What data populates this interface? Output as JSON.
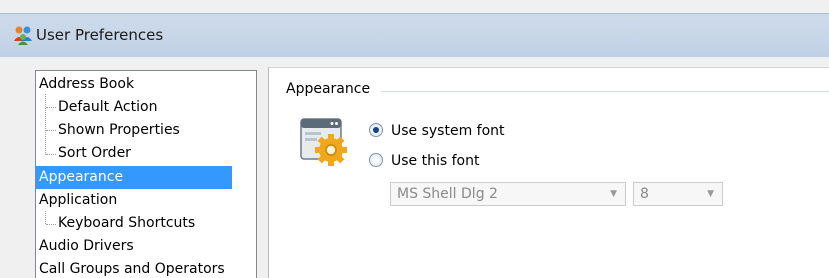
{
  "window": {
    "title": "User Preferences",
    "icon": "user-preferences-app-icon"
  },
  "tree": {
    "items": [
      {
        "label": "Address Book",
        "level": 0,
        "selected": false
      },
      {
        "label": "Default Action",
        "level": 1,
        "selected": false
      },
      {
        "label": "Shown Properties",
        "level": 1,
        "selected": false
      },
      {
        "label": "Sort Order",
        "level": 1,
        "selected": false
      },
      {
        "label": "Appearance",
        "level": 0,
        "selected": true
      },
      {
        "label": "Application",
        "level": 0,
        "selected": false
      },
      {
        "label": "Keyboard Shortcuts",
        "level": 1,
        "selected": false
      },
      {
        "label": "Audio Drivers",
        "level": 0,
        "selected": false
      },
      {
        "label": "Call Groups and Operators",
        "level": 0,
        "selected": false
      }
    ]
  },
  "panel": {
    "group_title": "Appearance",
    "icon": "window-settings-icon",
    "options": [
      {
        "label": "Use system font",
        "checked": true
      },
      {
        "label": "Use this font",
        "checked": false
      }
    ],
    "font_select": {
      "value": "MS Shell Dlg 2",
      "enabled": false
    },
    "size_select": {
      "value": "8",
      "enabled": false
    }
  },
  "colors": {
    "selection": "#3399ff",
    "titlebar": "#c7d6e8"
  }
}
